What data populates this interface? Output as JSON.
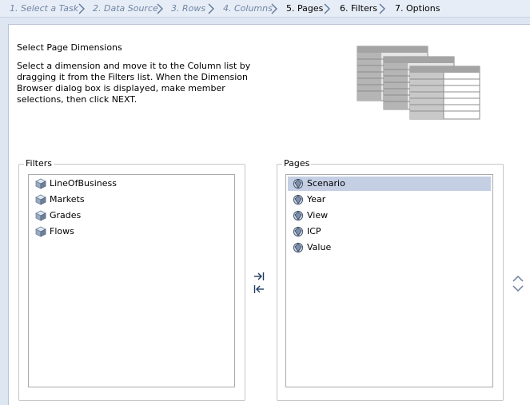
{
  "steps": [
    {
      "label": "1. Select a Task",
      "state": "done"
    },
    {
      "label": "2. Data Source",
      "state": "done"
    },
    {
      "label": "3. Rows",
      "state": "done"
    },
    {
      "label": "4. Columns",
      "state": "done"
    },
    {
      "label": "5. Pages",
      "state": "active"
    },
    {
      "label": "6. Filters",
      "state": "active"
    },
    {
      "label": "7. Options",
      "state": "active"
    }
  ],
  "page": {
    "heading": "Select Page Dimensions",
    "instructions": "Select a dimension and move it to the Column list by dragging it from the Filters list. When the Dimension Browser dialog box is displayed, make member selections, then click NEXT."
  },
  "filters": {
    "title": "Filters",
    "items": [
      "LineOfBusiness",
      "Markets",
      "Grades",
      "Flows"
    ],
    "icon": "cube-icon"
  },
  "pages": {
    "title": "Pages",
    "items": [
      "Scenario",
      "Year",
      "View",
      "ICP",
      "Value"
    ],
    "selected": "Scenario",
    "icon": "dimension-icon"
  },
  "colors": {
    "selection": "#c5cfe4",
    "crumb_done": "#6f86a6",
    "background": "#dde6f1"
  }
}
